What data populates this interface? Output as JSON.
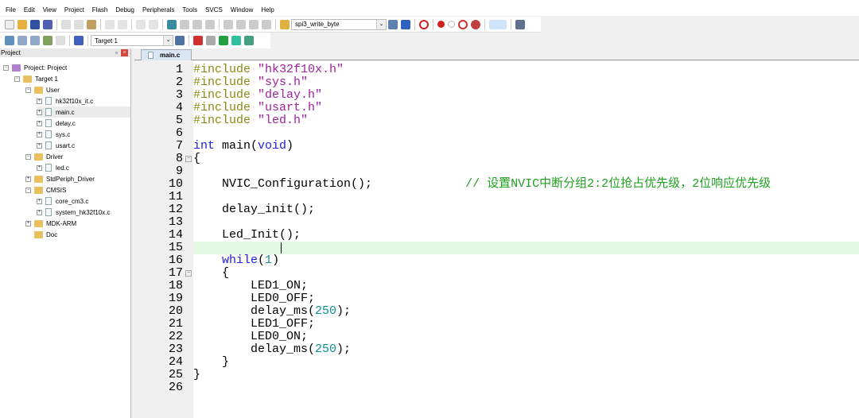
{
  "menu": [
    "File",
    "Edit",
    "View",
    "Project",
    "Flash",
    "Debug",
    "Peripherals",
    "Tools",
    "SVCS",
    "Window",
    "Help"
  ],
  "toolbar": {
    "function_combo": "spi3_write_byte",
    "target_combo": "Target 1"
  },
  "project_panel": {
    "title": "Project",
    "pin": "ᵖ",
    "close": "×",
    "tree": [
      {
        "label": "Project: Project",
        "level": 0,
        "kind": "project",
        "pm": "−"
      },
      {
        "label": "Target 1",
        "level": 1,
        "kind": "folder",
        "pm": "−"
      },
      {
        "label": "User",
        "level": 2,
        "kind": "folder",
        "pm": "−"
      },
      {
        "label": "hk32f10x_it.c",
        "level": 3,
        "kind": "file",
        "pm": "+"
      },
      {
        "label": "main.c",
        "level": 3,
        "kind": "file",
        "pm": "+",
        "selected": true
      },
      {
        "label": "delay.c",
        "level": 3,
        "kind": "file",
        "pm": "+"
      },
      {
        "label": "sys.c",
        "level": 3,
        "kind": "file",
        "pm": "+"
      },
      {
        "label": "usart.c",
        "level": 3,
        "kind": "file",
        "pm": "+"
      },
      {
        "label": "Driver",
        "level": 2,
        "kind": "folder",
        "pm": "−"
      },
      {
        "label": "led.c",
        "level": 3,
        "kind": "file",
        "pm": "+"
      },
      {
        "label": "StdPeriph_Driver",
        "level": 2,
        "kind": "folder",
        "pm": "+"
      },
      {
        "label": "CMSIS",
        "level": 2,
        "kind": "folder",
        "pm": "−"
      },
      {
        "label": "core_cm3.c",
        "level": 3,
        "kind": "file",
        "pm": "+"
      },
      {
        "label": "system_hk32f10x.c",
        "level": 3,
        "kind": "file",
        "pm": "+"
      },
      {
        "label": "MDK-ARM",
        "level": 2,
        "kind": "folder",
        "pm": "+"
      },
      {
        "label": "Doc",
        "level": 2,
        "kind": "folder",
        "pm": ""
      }
    ]
  },
  "editor": {
    "tab": "main.c",
    "current_line": 15,
    "lines": [
      [
        [
          "pp",
          "#include "
        ],
        [
          "str",
          "\"hk32f10x.h\""
        ]
      ],
      [
        [
          "pp",
          "#include "
        ],
        [
          "str",
          "\"sys.h\""
        ]
      ],
      [
        [
          "pp",
          "#include "
        ],
        [
          "str",
          "\"delay.h\""
        ]
      ],
      [
        [
          "pp",
          "#include "
        ],
        [
          "str",
          "\"usart.h\""
        ]
      ],
      [
        [
          "pp",
          "#include "
        ],
        [
          "str",
          "\"led.h\""
        ]
      ],
      [],
      [
        [
          "kw",
          "int"
        ],
        [
          "pl",
          " main("
        ],
        [
          "kw",
          "void"
        ],
        [
          "pl",
          ")"
        ]
      ],
      [
        [
          "pl",
          "{"
        ]
      ],
      [],
      [
        [
          "pl",
          "    NVIC_Configuration();             "
        ],
        [
          "cm",
          "// 设置NVIC中断分组2:2位抢占优先级，2位响应优先级"
        ]
      ],
      [],
      [
        [
          "pl",
          "    delay_init();"
        ]
      ],
      [],
      [
        [
          "pl",
          "    Led_Init();"
        ]
      ],
      [],
      [
        [
          "pl",
          "    "
        ],
        [
          "kw",
          "while"
        ],
        [
          "pl",
          "("
        ],
        [
          "num",
          "1"
        ],
        [
          "pl",
          ")"
        ]
      ],
      [
        [
          "pl",
          "    {"
        ]
      ],
      [
        [
          "pl",
          "        LED1_ON;"
        ]
      ],
      [
        [
          "pl",
          "        LED0_OFF;"
        ]
      ],
      [
        [
          "pl",
          "        delay_ms("
        ],
        [
          "num",
          "250"
        ],
        [
          "pl",
          ");"
        ]
      ],
      [
        [
          "pl",
          "        LED1_OFF;"
        ]
      ],
      [
        [
          "pl",
          "        LED0_ON;"
        ]
      ],
      [
        [
          "pl",
          "        delay_ms("
        ],
        [
          "num",
          "250"
        ],
        [
          "pl",
          ");"
        ]
      ],
      [
        [
          "pl",
          "    }"
        ]
      ],
      [
        [
          "pl",
          "}"
        ]
      ],
      []
    ],
    "fold_lines": [
      8,
      17
    ]
  }
}
